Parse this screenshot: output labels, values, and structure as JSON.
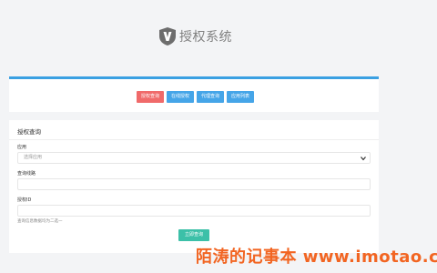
{
  "header": {
    "title": "授权系统",
    "logo_icon": "v-shield-icon"
  },
  "nav": {
    "accent_color": "#3aa0e2",
    "buttons": [
      {
        "label": "授权查询",
        "color": "#f06a6a"
      },
      {
        "label": "在线授权",
        "color": "#45a5e8"
      },
      {
        "label": "代理查询",
        "color": "#45a5e8"
      },
      {
        "label": "应用列表",
        "color": "#45a5e8"
      }
    ]
  },
  "form": {
    "title": "授权查询",
    "app_label": "应用",
    "app_selected": "选择应用",
    "query_label": "查询线路",
    "query_value": "",
    "auth_label": "授权ID",
    "auth_value": "",
    "hint": "查询信息数据均为二选一",
    "submit_label": "立即查询",
    "submit_color": "#3cc0a8"
  },
  "watermark": {
    "text": "陌涛的记事本 www.imotao.c"
  }
}
